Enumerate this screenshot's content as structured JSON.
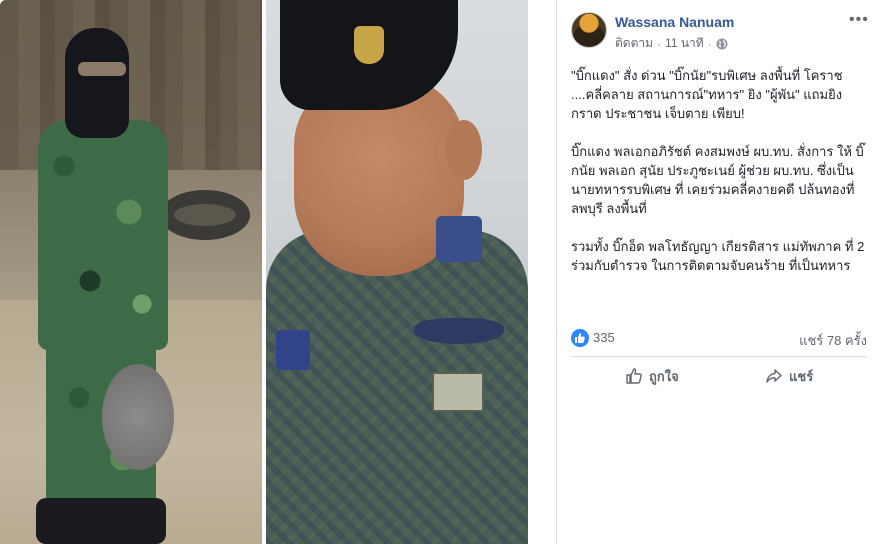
{
  "post": {
    "author": "Wassana Nanuam",
    "follow_label": "ติดตาม",
    "separator": "·",
    "time": "11 นาที",
    "more_label": "•••",
    "paragraphs": [
      "\"บิ๊กแดง\" สั่ง ด่วน \"บิ๊กนัย\"รบพิเศษ ลงพื้นที่ โคราช ....คลี่คลาย สถานการณ์\"ทหาร\" ยิง \"ผู้พัน\" แถมยิงกราด ประชาชน เจ็บตาย เพียบ!",
      "บิ๊กแดง พลเอกอภิรัชต์ คงสมพงษ์ ผบ.ทบ. สั่งการ ให้ บิ๊กนัย พลเอก สุนัย ประภูชะเนย์ ผู้ช่วย ผบ.ทบ. ซึ่งเป็น นายทหารรบพิเศษ ที่ เคยร่วมคลี่คงายคดี ปล้นทองที่ลพบุรี ลงพื้นที่",
      "รวมทั้ง บิ๊กอ็ด พลโทธัญญา เกียรติสาร แม่ทัพภาค ที่ 2 ร่วมกับตำรวจ ในการติดตามจับคนร้าย ที่เป็นทหาร"
    ],
    "like_count": "335",
    "share_count": "แชร์ 78 ครั้ง",
    "like_button": "ถูกใจ",
    "share_button": "แชร์"
  },
  "colors": {
    "author_link": "#365899",
    "like_blue": "#2d88ff",
    "meta_gray": "#616770"
  }
}
